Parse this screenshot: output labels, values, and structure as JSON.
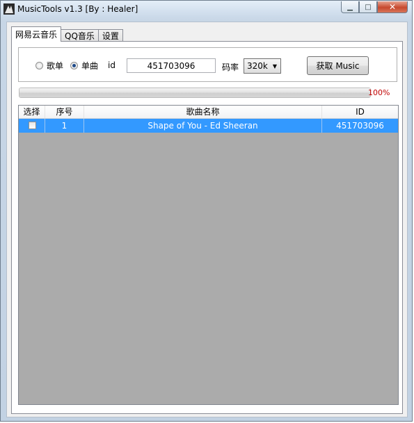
{
  "window": {
    "title": "MusicTools v1.3 [By : Healer]",
    "controls": {
      "minimize": "▁",
      "maximize": "□",
      "close": "✕"
    }
  },
  "tabs": [
    {
      "label": "网易云音乐",
      "active": true
    },
    {
      "label": "QQ音乐",
      "active": false
    },
    {
      "label": "设置",
      "active": false
    }
  ],
  "form": {
    "radio_playlist_label": "歌单",
    "radio_single_label": "单曲",
    "selected_mode": "单曲",
    "id_label": "id",
    "id_value": "451703096",
    "bitrate_label": "码率",
    "bitrate_value": "320k",
    "fetch_button": "获取 Music"
  },
  "progress": {
    "value": 1.0,
    "text": "100%"
  },
  "table": {
    "columns": [
      "选择",
      "序号",
      "歌曲名称",
      "ID"
    ],
    "rows": [
      {
        "checked": false,
        "index": "1",
        "name": "Shape of You - Ed Sheeran",
        "id": "451703096",
        "selected": true
      }
    ]
  },
  "colors": {
    "selection": "#3399ff",
    "percent_text": "#c00000",
    "list_background": "#ababab"
  }
}
